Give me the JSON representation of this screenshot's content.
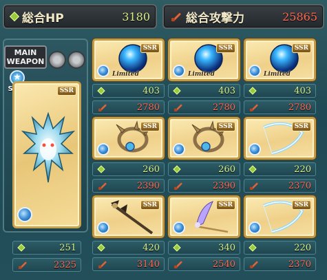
{
  "header": {
    "hp_label": "総合HP",
    "hp_value": "3180",
    "atk_label": "総合攻撃力",
    "atk_value": "25865"
  },
  "main_weapon": {
    "label_line1": "MAIN",
    "label_line2": "WEAPON",
    "skin_label": "SKIN",
    "rarity": "SSR",
    "hp": "251",
    "atk": "2325",
    "element": "water"
  },
  "grid": [
    {
      "rarity": "SSR",
      "tag": "Limited",
      "art": "blue-orb",
      "hp": "403",
      "atk": "2780"
    },
    {
      "rarity": "SSR",
      "tag": "Limited",
      "art": "blue-orb",
      "hp": "403",
      "atk": "2780"
    },
    {
      "rarity": "SSR",
      "tag": "Limited",
      "art": "blue-orb",
      "hp": "403",
      "atk": "2780"
    },
    {
      "rarity": "SSR",
      "tag": "",
      "art": "horned-ring",
      "hp": "260",
      "atk": "2390"
    },
    {
      "rarity": "SSR",
      "tag": "",
      "art": "horned-ring",
      "hp": "260",
      "atk": "2390"
    },
    {
      "rarity": "SSR",
      "tag": "",
      "art": "crystal-bow",
      "hp": "220",
      "atk": "2370"
    },
    {
      "rarity": "SSR",
      "tag": "",
      "art": "dark-staff",
      "hp": "420",
      "atk": "3140"
    },
    {
      "rarity": "SSR",
      "tag": "",
      "art": "wing-staff",
      "hp": "340",
      "atk": "2540"
    },
    {
      "rarity": "SSR",
      "tag": "",
      "art": "crystal-bow",
      "hp": "220",
      "atk": "2370"
    }
  ],
  "colors": {
    "hp_text": "#d9f08a",
    "atk_text": "#ff6a52",
    "card_gold": "#efd089",
    "panel_teal": "#1f4a55"
  }
}
